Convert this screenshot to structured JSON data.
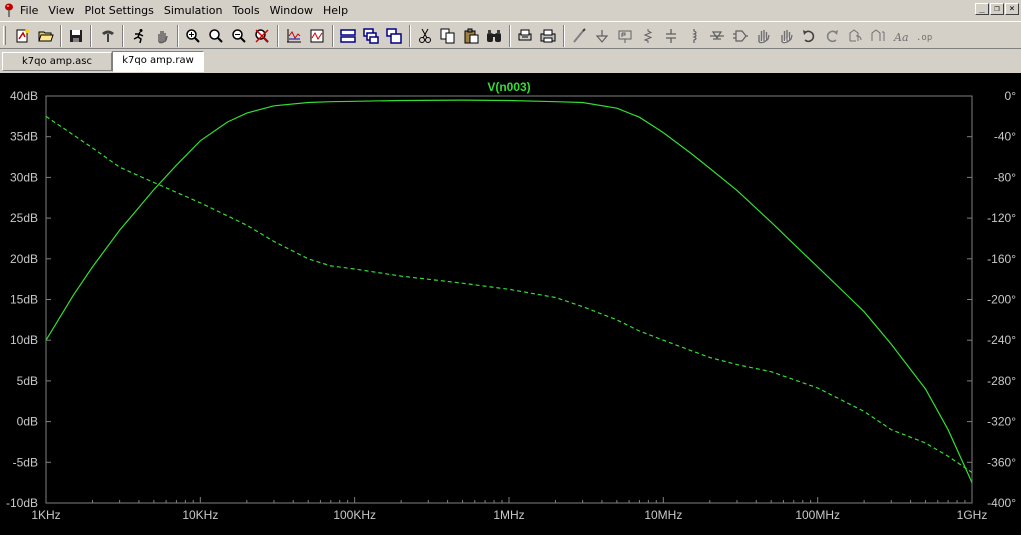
{
  "menu": {
    "items": [
      "File",
      "View",
      "Plot Settings",
      "Simulation",
      "Tools",
      "Window",
      "Help"
    ]
  },
  "window_controls": [
    "_",
    "❐",
    "×"
  ],
  "toolbar": {
    "buttons": [
      "new-schematic-icon",
      "open-icon",
      "save-icon",
      "control-panel-icon",
      "run-icon",
      "halt-icon",
      "zoom-in-icon",
      "zoom-area-icon",
      "zoom-out-icon",
      "zoom-cancel-icon",
      "autorange-icon",
      "add-trace-icon",
      "tile-horizontal-icon",
      "cascade-icon",
      "tile-vertical-icon",
      "cut-icon",
      "copy-icon",
      "paste-icon",
      "find-icon",
      "print-setup-icon",
      "print-icon",
      "wire-icon",
      "ground-icon",
      "label-net-icon",
      "resistor-icon",
      "capacitor-icon",
      "inductor-icon",
      "diode-icon",
      "component-icon",
      "move-icon",
      "drag-icon",
      "undo-icon",
      "redo-icon",
      "rotate-icon",
      "mirror-icon",
      "text-icon",
      "spice-directive-icon"
    ]
  },
  "tabs": [
    {
      "label": "k7qo amp.asc",
      "active": false
    },
    {
      "label": "k7qo amp.raw",
      "active": true
    }
  ],
  "chart_data": {
    "type": "line",
    "title": "V(n003)",
    "x_scale": "log",
    "xlim_hz": [
      1000,
      1000000000
    ],
    "x_ticks": [
      {
        "value": 1000,
        "label": "1KHz"
      },
      {
        "value": 10000,
        "label": "10KHz"
      },
      {
        "value": 100000,
        "label": "100KHz"
      },
      {
        "value": 1000000,
        "label": "1MHz"
      },
      {
        "value": 10000000,
        "label": "10MHz"
      },
      {
        "value": 100000000,
        "label": "100MHz"
      },
      {
        "value": 1000000000,
        "label": "1GHz"
      }
    ],
    "y_left": {
      "unit": "dB",
      "ylim": [
        -10,
        40
      ],
      "ticks": [
        "40dB",
        "35dB",
        "30dB",
        "25dB",
        "20dB",
        "15dB",
        "10dB",
        "5dB",
        "0dB",
        "-5dB",
        "-10dB"
      ],
      "tick_values": [
        40,
        35,
        30,
        25,
        20,
        15,
        10,
        5,
        0,
        -5,
        -10
      ]
    },
    "y_right": {
      "unit": "degrees",
      "ylim": [
        -400,
        0
      ],
      "ticks": [
        "0°",
        "-40°",
        "-80°",
        "-120°",
        "-160°",
        "-200°",
        "-240°",
        "-280°",
        "-320°",
        "-360°",
        "-400°"
      ],
      "tick_values": [
        0,
        -40,
        -80,
        -120,
        -160,
        -200,
        -240,
        -280,
        -320,
        -360,
        -400
      ]
    },
    "grid": false,
    "color": "#33dd33",
    "series": [
      {
        "name": "V(n003)",
        "kind": "magnitude",
        "axis": "left",
        "style": "solid",
        "x": [
          1000,
          1500,
          2000,
          3000,
          5000,
          7000,
          10000,
          15000,
          20000,
          30000,
          50000,
          70000,
          100000,
          200000,
          500000,
          1000000,
          2000000,
          3000000,
          5000000,
          7000000,
          10000000,
          15000000,
          20000000,
          30000000,
          50000000,
          70000000,
          100000000,
          150000000,
          200000000,
          300000000,
          500000000,
          700000000,
          1000000000
        ],
        "y": [
          10,
          15.5,
          19,
          23.5,
          28.5,
          31.5,
          34.5,
          36.8,
          37.9,
          38.8,
          39.2,
          39.3,
          39.35,
          39.45,
          39.5,
          39.45,
          39.3,
          39.2,
          38.5,
          37.4,
          35.5,
          33,
          31.1,
          28.4,
          24.5,
          21.8,
          19,
          15.8,
          13.5,
          9.5,
          4,
          -1,
          -7.5
        ]
      },
      {
        "name": "V(n003)",
        "kind": "phase",
        "axis": "right",
        "style": "dashed",
        "x": [
          1000,
          2000,
          3000,
          5000,
          10000,
          20000,
          30000,
          50000,
          70000,
          100000,
          200000,
          500000,
          1000000,
          2000000,
          3000000,
          5000000,
          7000000,
          10000000,
          15000000,
          20000000,
          30000000,
          50000000,
          100000000,
          200000000,
          300000000,
          500000000,
          700000000,
          1000000000
        ],
        "y": [
          -20,
          -51,
          -70,
          -85,
          -105,
          -127,
          -143,
          -160,
          -167,
          -170,
          -177,
          -184,
          -190,
          -198,
          -207,
          -220,
          -231,
          -240,
          -250,
          -257,
          -264,
          -271,
          -287,
          -310,
          -328,
          -341,
          -354,
          -370
        ]
      }
    ]
  }
}
